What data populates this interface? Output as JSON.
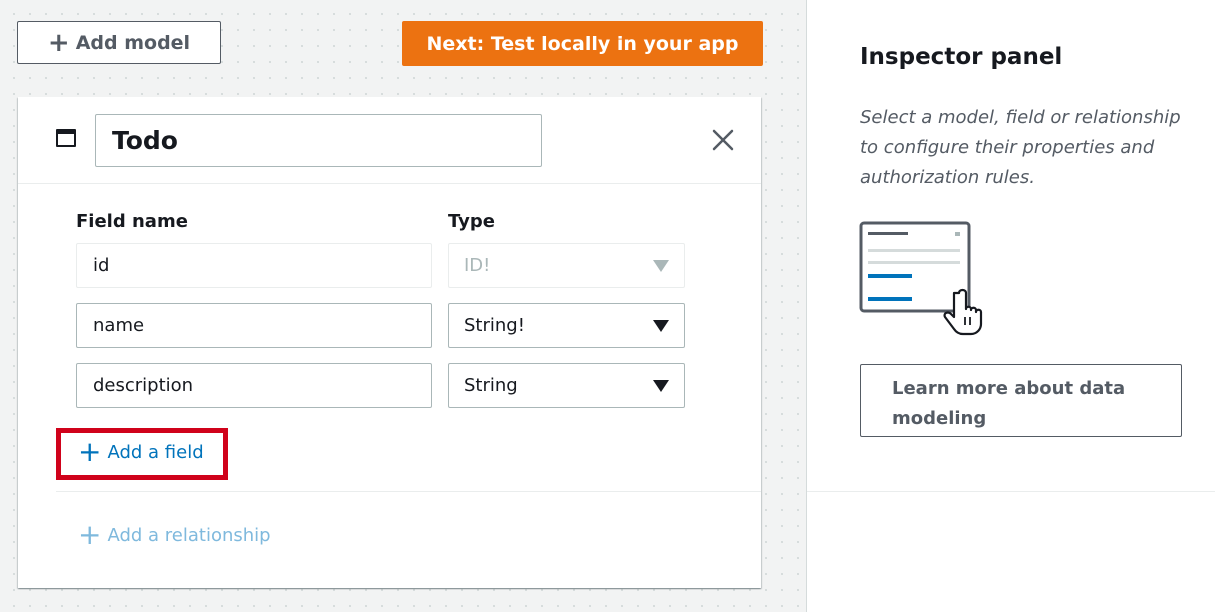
{
  "toolbar": {
    "add_model_label": "Add model",
    "next_label": "Next: Test locally in your app"
  },
  "model": {
    "name": "Todo",
    "columns": {
      "field_name": "Field name",
      "type": "Type"
    },
    "fields": [
      {
        "name": "id",
        "type": "ID!",
        "editable": false
      },
      {
        "name": "name",
        "type": "String!",
        "editable": true
      },
      {
        "name": "description",
        "type": "String",
        "editable": true
      }
    ],
    "add_field_label": "Add a field",
    "add_relationship_label": "Add a relationship"
  },
  "inspector": {
    "title": "Inspector panel",
    "description": "Select a model, field or relationship to configure their properties and authorization rules.",
    "learn_more_label": "Learn more about data modeling"
  },
  "icons": {
    "plus": "plus-icon",
    "close": "close-icon",
    "model": "model-window-icon",
    "caret": "caret-down-icon",
    "illustration": "inspector-pointer-illustration"
  },
  "colors": {
    "primary": "#ec7211",
    "link": "#0073bb",
    "highlight": "#d0021b"
  }
}
